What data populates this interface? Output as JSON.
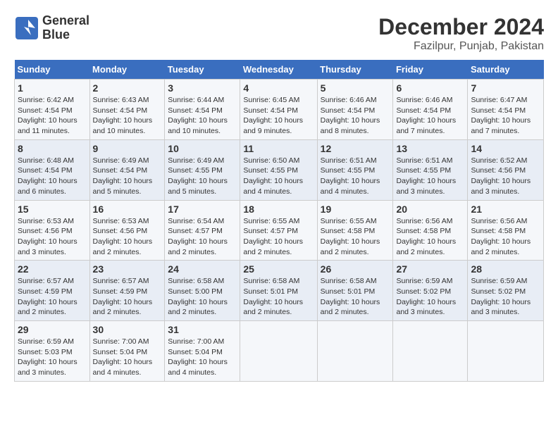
{
  "header": {
    "logo_line1": "General",
    "logo_line2": "Blue",
    "title": "December 2024",
    "subtitle": "Fazilpur, Punjab, Pakistan"
  },
  "calendar": {
    "days_of_week": [
      "Sunday",
      "Monday",
      "Tuesday",
      "Wednesday",
      "Thursday",
      "Friday",
      "Saturday"
    ],
    "weeks": [
      [
        {
          "day": "1",
          "sunrise": "6:42 AM",
          "sunset": "4:54 PM",
          "daylight": "10 hours and 11 minutes."
        },
        {
          "day": "2",
          "sunrise": "6:43 AM",
          "sunset": "4:54 PM",
          "daylight": "10 hours and 10 minutes."
        },
        {
          "day": "3",
          "sunrise": "6:44 AM",
          "sunset": "4:54 PM",
          "daylight": "10 hours and 10 minutes."
        },
        {
          "day": "4",
          "sunrise": "6:45 AM",
          "sunset": "4:54 PM",
          "daylight": "10 hours and 9 minutes."
        },
        {
          "day": "5",
          "sunrise": "6:46 AM",
          "sunset": "4:54 PM",
          "daylight": "10 hours and 8 minutes."
        },
        {
          "day": "6",
          "sunrise": "6:46 AM",
          "sunset": "4:54 PM",
          "daylight": "10 hours and 7 minutes."
        },
        {
          "day": "7",
          "sunrise": "6:47 AM",
          "sunset": "4:54 PM",
          "daylight": "10 hours and 7 minutes."
        }
      ],
      [
        {
          "day": "8",
          "sunrise": "6:48 AM",
          "sunset": "4:54 PM",
          "daylight": "10 hours and 6 minutes."
        },
        {
          "day": "9",
          "sunrise": "6:49 AM",
          "sunset": "4:54 PM",
          "daylight": "10 hours and 5 minutes."
        },
        {
          "day": "10",
          "sunrise": "6:49 AM",
          "sunset": "4:55 PM",
          "daylight": "10 hours and 5 minutes."
        },
        {
          "day": "11",
          "sunrise": "6:50 AM",
          "sunset": "4:55 PM",
          "daylight": "10 hours and 4 minutes."
        },
        {
          "day": "12",
          "sunrise": "6:51 AM",
          "sunset": "4:55 PM",
          "daylight": "10 hours and 4 minutes."
        },
        {
          "day": "13",
          "sunrise": "6:51 AM",
          "sunset": "4:55 PM",
          "daylight": "10 hours and 3 minutes."
        },
        {
          "day": "14",
          "sunrise": "6:52 AM",
          "sunset": "4:56 PM",
          "daylight": "10 hours and 3 minutes."
        }
      ],
      [
        {
          "day": "15",
          "sunrise": "6:53 AM",
          "sunset": "4:56 PM",
          "daylight": "10 hours and 3 minutes."
        },
        {
          "day": "16",
          "sunrise": "6:53 AM",
          "sunset": "4:56 PM",
          "daylight": "10 hours and 2 minutes."
        },
        {
          "day": "17",
          "sunrise": "6:54 AM",
          "sunset": "4:57 PM",
          "daylight": "10 hours and 2 minutes."
        },
        {
          "day": "18",
          "sunrise": "6:55 AM",
          "sunset": "4:57 PM",
          "daylight": "10 hours and 2 minutes."
        },
        {
          "day": "19",
          "sunrise": "6:55 AM",
          "sunset": "4:58 PM",
          "daylight": "10 hours and 2 minutes."
        },
        {
          "day": "20",
          "sunrise": "6:56 AM",
          "sunset": "4:58 PM",
          "daylight": "10 hours and 2 minutes."
        },
        {
          "day": "21",
          "sunrise": "6:56 AM",
          "sunset": "4:58 PM",
          "daylight": "10 hours and 2 minutes."
        }
      ],
      [
        {
          "day": "22",
          "sunrise": "6:57 AM",
          "sunset": "4:59 PM",
          "daylight": "10 hours and 2 minutes."
        },
        {
          "day": "23",
          "sunrise": "6:57 AM",
          "sunset": "4:59 PM",
          "daylight": "10 hours and 2 minutes."
        },
        {
          "day": "24",
          "sunrise": "6:58 AM",
          "sunset": "5:00 PM",
          "daylight": "10 hours and 2 minutes."
        },
        {
          "day": "25",
          "sunrise": "6:58 AM",
          "sunset": "5:01 PM",
          "daylight": "10 hours and 2 minutes."
        },
        {
          "day": "26",
          "sunrise": "6:58 AM",
          "sunset": "5:01 PM",
          "daylight": "10 hours and 2 minutes."
        },
        {
          "day": "27",
          "sunrise": "6:59 AM",
          "sunset": "5:02 PM",
          "daylight": "10 hours and 3 minutes."
        },
        {
          "day": "28",
          "sunrise": "6:59 AM",
          "sunset": "5:02 PM",
          "daylight": "10 hours and 3 minutes."
        }
      ],
      [
        {
          "day": "29",
          "sunrise": "6:59 AM",
          "sunset": "5:03 PM",
          "daylight": "10 hours and 3 minutes."
        },
        {
          "day": "30",
          "sunrise": "7:00 AM",
          "sunset": "5:04 PM",
          "daylight": "10 hours and 4 minutes."
        },
        {
          "day": "31",
          "sunrise": "7:00 AM",
          "sunset": "5:04 PM",
          "daylight": "10 hours and 4 minutes."
        },
        null,
        null,
        null,
        null
      ]
    ]
  }
}
